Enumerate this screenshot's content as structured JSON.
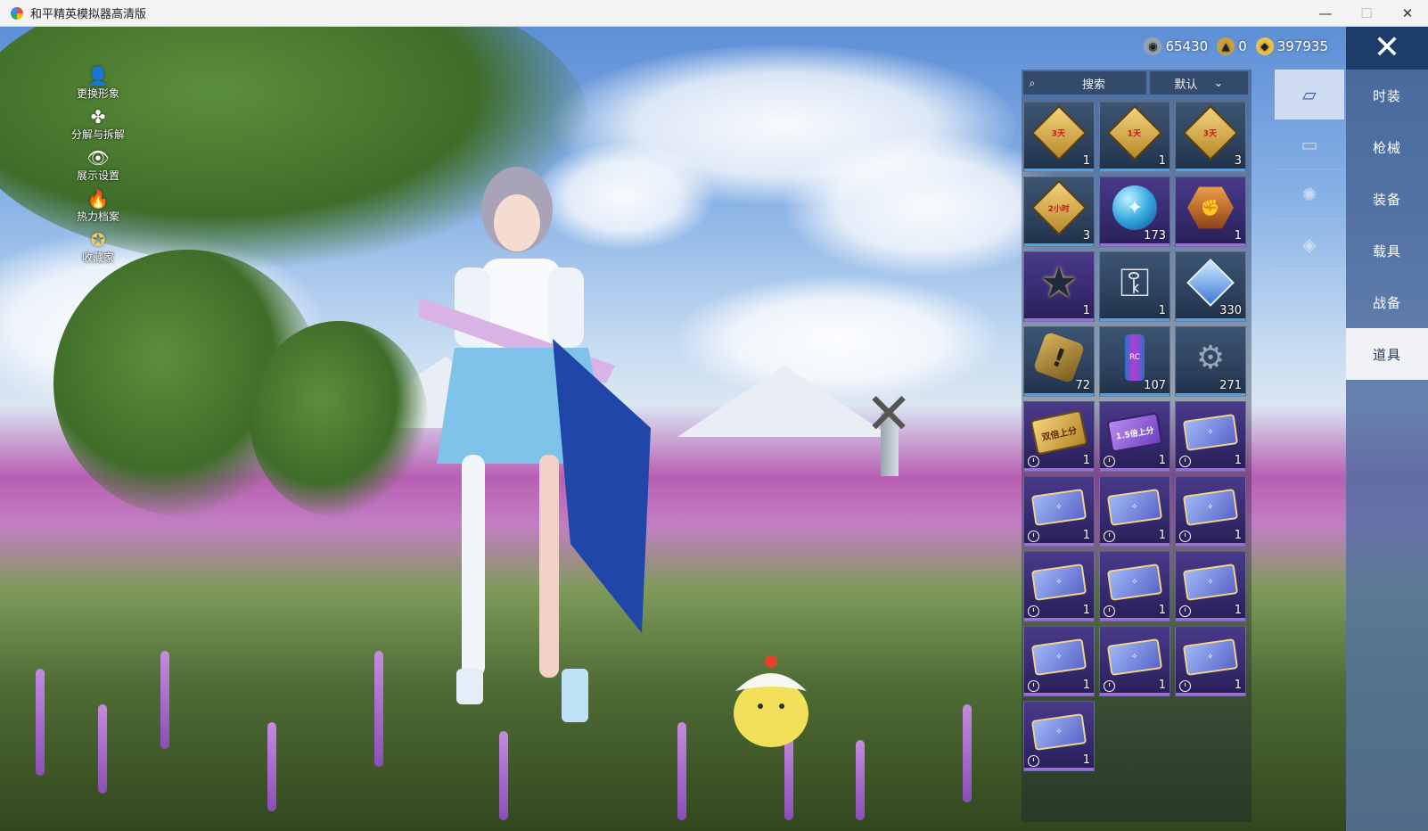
{
  "window": {
    "title": "和平精英模拟器高清版",
    "controls": {
      "minimize": "—",
      "maximize": "☐",
      "close": "✕"
    }
  },
  "left_menu": [
    {
      "label": "更换形象",
      "icon": "person-icon",
      "glyph": "👤"
    },
    {
      "label": "分解与拆解",
      "icon": "puzzle-icon",
      "glyph": "✤"
    },
    {
      "label": "展示设置",
      "icon": "eye-icon",
      "glyph": "👁"
    },
    {
      "label": "热力档案",
      "icon": "flame-icon",
      "glyph": "🔥"
    },
    {
      "label": "收藏家",
      "icon": "collector-badge-icon",
      "glyph": "✪"
    }
  ],
  "currencies": [
    {
      "icon": "silver-coin-icon",
      "value": "65430",
      "color": "#9aa3ad"
    },
    {
      "icon": "gold-token-icon",
      "value": "0",
      "color": "#c9a040"
    },
    {
      "icon": "gold-coin-icon",
      "value": "397935",
      "color": "#e8c14a"
    }
  ],
  "close_glyph": "✕",
  "categories": [
    {
      "label": "时装",
      "active": false
    },
    {
      "label": "枪械",
      "active": false
    },
    {
      "label": "装备",
      "active": false
    },
    {
      "label": "载具",
      "active": false
    },
    {
      "label": "战备",
      "active": false
    },
    {
      "label": "道具",
      "active": true
    }
  ],
  "subtabs": [
    {
      "icon": "card-icon",
      "glyph": "▱",
      "active": true
    },
    {
      "icon": "chest-icon",
      "glyph": "▭",
      "active": false
    },
    {
      "icon": "firework-icon",
      "glyph": "✺",
      "active": false
    },
    {
      "icon": "ticket-icon",
      "glyph": "◈",
      "active": false
    }
  ],
  "search": {
    "placeholder": "搜索",
    "icon": "search-icon"
  },
  "sort": {
    "value": "默认",
    "icon": "chevron-down-icon"
  },
  "items": [
    {
      "name": "exp-card-1.5x-3day",
      "kind": "diamond-gold",
      "text": "3天",
      "count": "1",
      "timed": false,
      "rarity": "blue"
    },
    {
      "name": "exp-card-2x-1day",
      "kind": "diamond-gold",
      "text": "1天",
      "count": "1",
      "timed": false,
      "rarity": "blue"
    },
    {
      "name": "exp-card-2x-3day",
      "kind": "diamond-gold",
      "text": "3天",
      "count": "3",
      "timed": false,
      "rarity": "blue"
    },
    {
      "name": "exp-card-2x-2hour",
      "kind": "diamond-gold",
      "text": "2小时",
      "count": "3",
      "timed": false,
      "rarity": "blue"
    },
    {
      "name": "puzzle-orb",
      "kind": "orb",
      "text": "",
      "count": "173",
      "timed": false,
      "rarity": "purple"
    },
    {
      "name": "medal-badge",
      "kind": "hex",
      "text": "",
      "count": "1",
      "timed": false,
      "rarity": "purple"
    },
    {
      "name": "star-emblem",
      "kind": "star",
      "text": "",
      "count": "1",
      "timed": false,
      "rarity": "purple"
    },
    {
      "name": "cloud-key",
      "kind": "key",
      "text": "",
      "count": "1",
      "timed": false,
      "rarity": "blue"
    },
    {
      "name": "blue-diamond",
      "kind": "gem",
      "text": "",
      "count": "330",
      "timed": false,
      "rarity": "blue"
    },
    {
      "name": "exclaim-token",
      "kind": "badge-ex",
      "text": "",
      "count": "72",
      "timed": false,
      "rarity": "blue"
    },
    {
      "name": "spray-can",
      "kind": "can",
      "text": "",
      "count": "107",
      "timed": false,
      "rarity": "blue"
    },
    {
      "name": "spray-gun",
      "kind": "gun",
      "text": "",
      "count": "271",
      "timed": false,
      "rarity": "blue"
    },
    {
      "name": "double-score-card",
      "kind": "card-gold",
      "text": "双倍上分",
      "count": "1",
      "timed": true,
      "rarity": "purple"
    },
    {
      "name": "1.5x-score-card",
      "kind": "card-purple",
      "text": "1.5倍上分",
      "count": "1",
      "timed": true,
      "rarity": "purple"
    },
    {
      "name": "ticket-1",
      "kind": "card-ticket",
      "text": "",
      "count": "1",
      "timed": true,
      "rarity": "purple"
    },
    {
      "name": "ticket-2",
      "kind": "card-ticket",
      "text": "",
      "count": "1",
      "timed": true,
      "rarity": "purple"
    },
    {
      "name": "ticket-3",
      "kind": "card-ticket",
      "text": "",
      "count": "1",
      "timed": true,
      "rarity": "purple"
    },
    {
      "name": "ticket-4",
      "kind": "card-ticket",
      "text": "",
      "count": "1",
      "timed": true,
      "rarity": "purple"
    },
    {
      "name": "ticket-5",
      "kind": "card-ticket",
      "text": "",
      "count": "1",
      "timed": true,
      "rarity": "purple"
    },
    {
      "name": "ticket-6",
      "kind": "card-ticket",
      "text": "",
      "count": "1",
      "timed": true,
      "rarity": "purple"
    },
    {
      "name": "ticket-7",
      "kind": "card-ticket",
      "text": "",
      "count": "1",
      "timed": true,
      "rarity": "purple"
    },
    {
      "name": "ticket-8",
      "kind": "card-ticket",
      "text": "",
      "count": "1",
      "timed": true,
      "rarity": "purple"
    },
    {
      "name": "ticket-9",
      "kind": "card-ticket",
      "text": "",
      "count": "1",
      "timed": true,
      "rarity": "purple"
    },
    {
      "name": "ticket-10",
      "kind": "card-ticket",
      "text": "",
      "count": "1",
      "timed": true,
      "rarity": "purple"
    },
    {
      "name": "ticket-11",
      "kind": "card-ticket",
      "text": "",
      "count": "1",
      "timed": true,
      "rarity": "purple"
    }
  ]
}
